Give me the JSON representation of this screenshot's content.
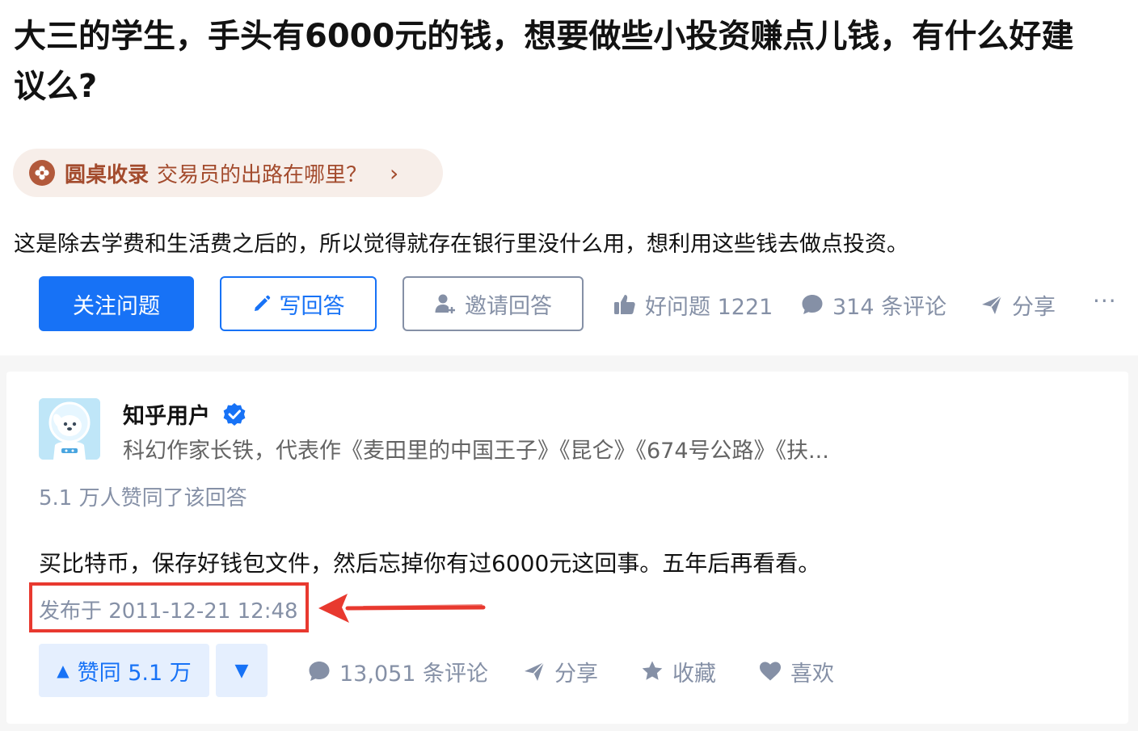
{
  "question": {
    "title": "大三的学生，手头有6000元的钱，想要做些小投资赚点儿钱，有什么好建议么?",
    "roundtable": {
      "kind": "圆桌收录",
      "name": "交易员的出路在哪里？",
      "arrow": "›"
    },
    "detail": "这是除去学费和生活费之后的，所以觉得就存在银行里没什么用，想利用这些钱去做点投资。",
    "buttons": {
      "follow": "关注问题",
      "write": "写回答",
      "invite": "邀请回答"
    },
    "actions": {
      "good_question": "好问题 1221",
      "comments": "314 条评论",
      "share": "分享",
      "more": "···"
    }
  },
  "answer": {
    "author": {
      "name": "知乎用户",
      "headline": "科幻作家长铁，代表作《麦田里的中国王子》《昆仑》《674号公路》《扶..."
    },
    "votes_info": "5.1 万人赞同了该回答",
    "content": "买比特币，保存好钱包文件，然后忘掉你有过6000元这回事。五年后再看看。",
    "publish_time": "发布于 2011-12-21 12:48",
    "vote_up": "赞同 5.1 万",
    "vote_up_icon": "▲",
    "vote_down_icon": "▼",
    "actions": {
      "comments": "13,051 条评论",
      "share": "分享",
      "collect": "收藏",
      "like": "喜欢"
    }
  },
  "colors": {
    "brand_blue": "#1772f6",
    "gray_text": "#8590a6",
    "roundtable_bg": "#f7eee9",
    "roundtable_text": "#a34b2d",
    "annotation_red": "#e8392f"
  }
}
